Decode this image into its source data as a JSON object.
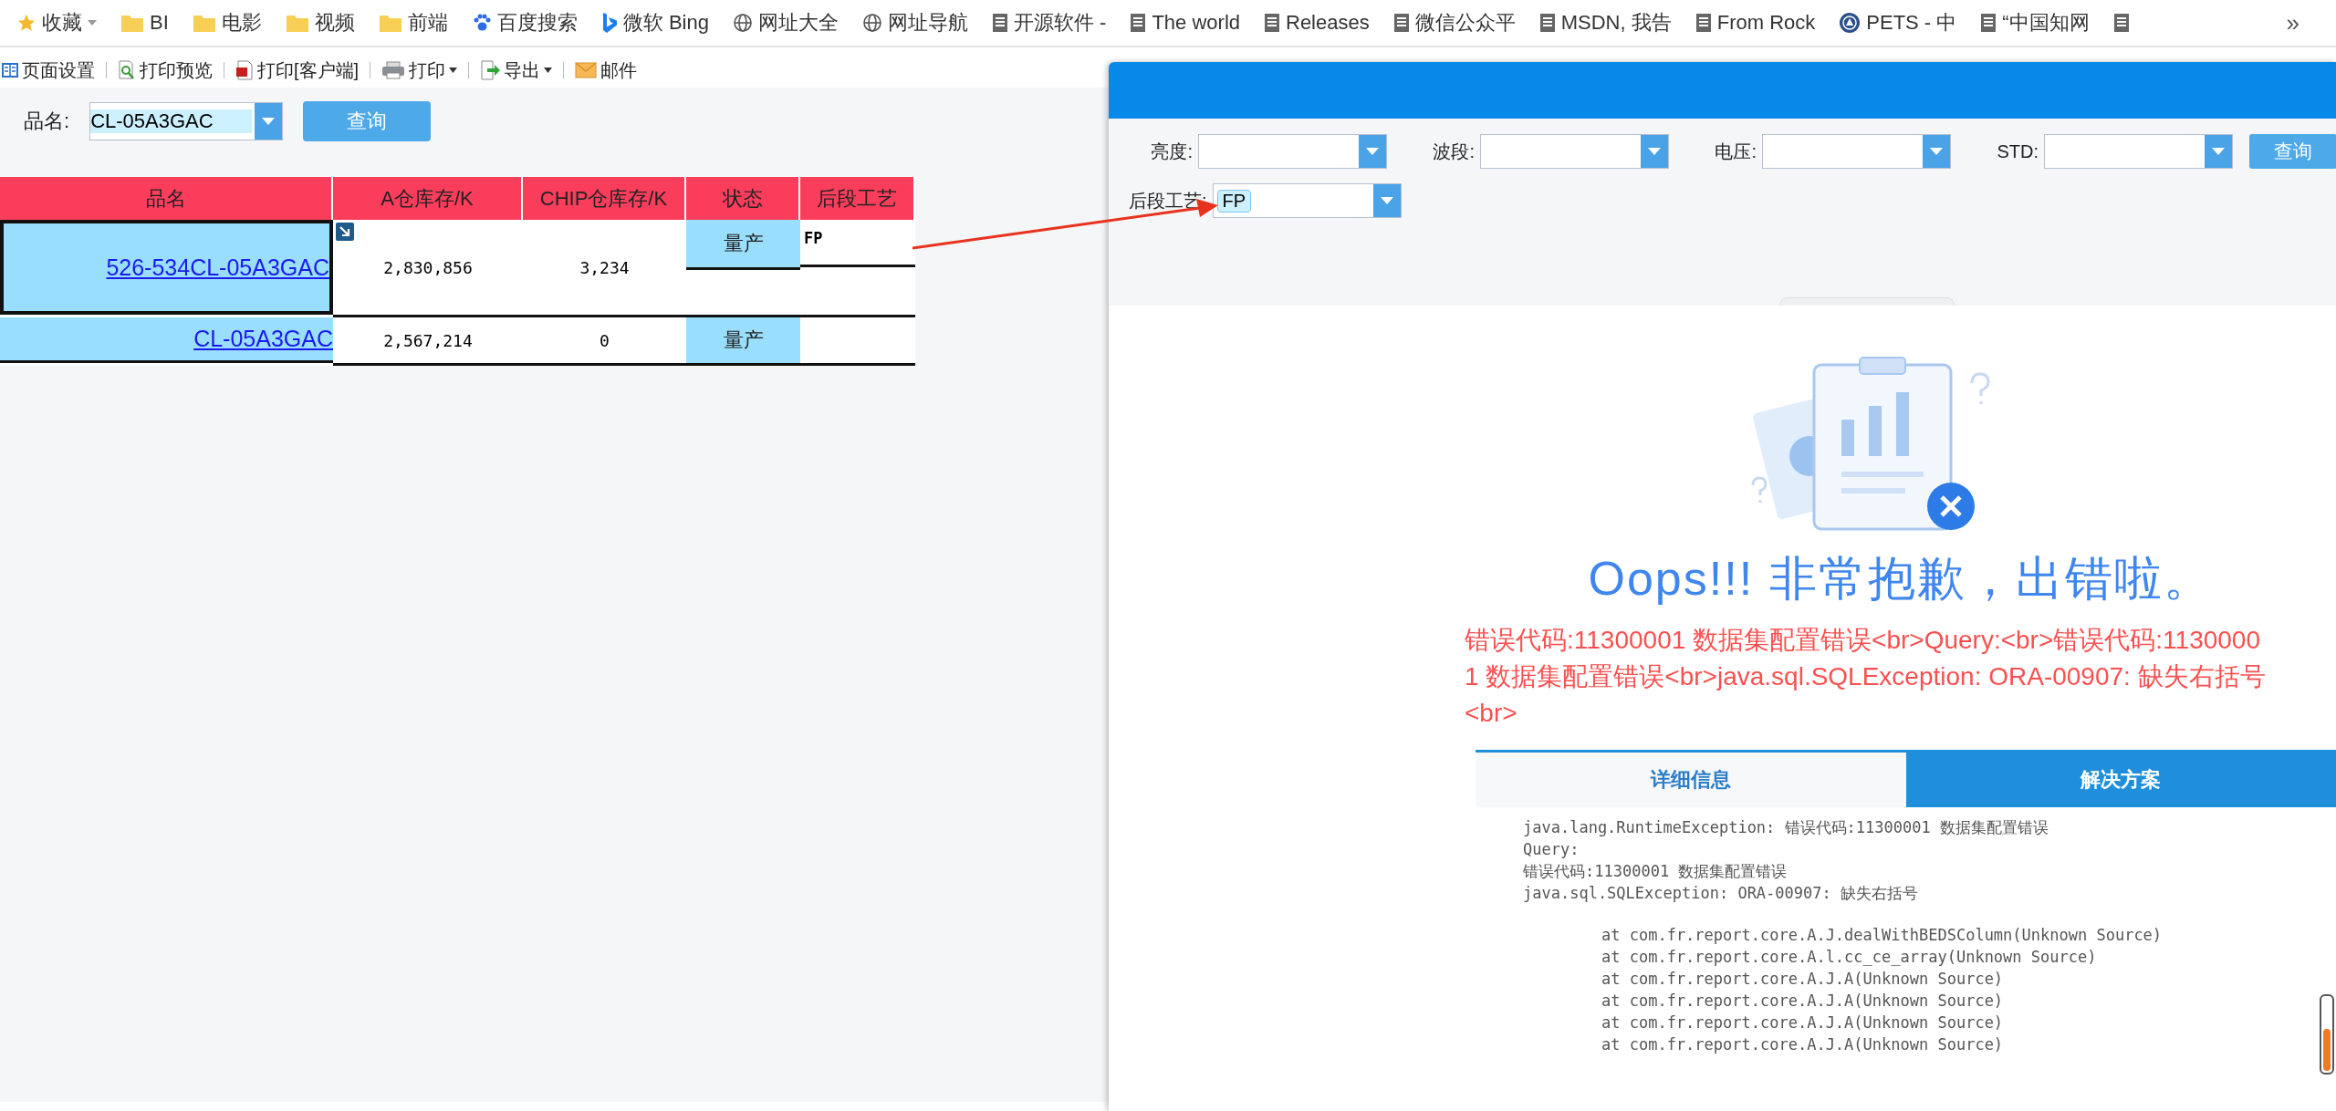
{
  "bookmarks": [
    {
      "kind": "star",
      "label": "收藏",
      "dropdown": true
    },
    {
      "kind": "folder",
      "label": "BI",
      "dropdown": false
    },
    {
      "kind": "folder",
      "label": "电影",
      "dropdown": false
    },
    {
      "kind": "folder",
      "label": "视频",
      "dropdown": false
    },
    {
      "kind": "folder",
      "label": "前端",
      "dropdown": false
    },
    {
      "kind": "paw",
      "label": "百度搜索",
      "dropdown": false
    },
    {
      "kind": "bing",
      "label": "微软 Bing",
      "dropdown": false
    },
    {
      "kind": "globe",
      "label": "网址大全",
      "dropdown": false
    },
    {
      "kind": "globe",
      "label": "网址导航",
      "dropdown": false
    },
    {
      "kind": "page",
      "label": "开源软件 -",
      "dropdown": false
    },
    {
      "kind": "page",
      "label": "The world",
      "dropdown": false
    },
    {
      "kind": "page",
      "label": "Releases",
      "dropdown": false
    },
    {
      "kind": "page",
      "label": "微信公众平",
      "dropdown": false
    },
    {
      "kind": "page",
      "label": "MSDN, 我告",
      "dropdown": false
    },
    {
      "kind": "page",
      "label": "From Rock",
      "dropdown": false
    },
    {
      "kind": "seal",
      "label": "PETS - 中",
      "dropdown": false
    },
    {
      "kind": "page",
      "label": "“中国知网",
      "dropdown": false
    },
    {
      "kind": "page",
      "dropdown": false
    }
  ],
  "bookmarks_overflow": "»",
  "toolbar": [
    {
      "kind": "layout",
      "label": "页面设置",
      "dropdown": false
    },
    {
      "kind": "preview",
      "label": "打印预览",
      "dropdown": false
    },
    {
      "kind": "pdf",
      "label": "打印[客户端]",
      "dropdown": false
    },
    {
      "kind": "printer",
      "label": "打印",
      "dropdown": true
    },
    {
      "kind": "export",
      "label": "导出",
      "dropdown": true
    },
    {
      "kind": "mail",
      "label": "邮件",
      "dropdown": false
    }
  ],
  "report": {
    "filter": {
      "label": "品名:",
      "value": "CL-05A3GAC",
      "button": "查询"
    },
    "table": {
      "columns": [
        "品名",
        "A仓库存/K",
        "CHIP仓库存/K",
        "状态",
        "后段工艺"
      ],
      "rows": [
        {
          "name": "526-534CL-05A3GAC",
          "a_stock": "2,830,856",
          "chip_stock": "3,234",
          "status": "量产",
          "process": "FP",
          "selected": true
        },
        {
          "name": "CL-05A3GAC",
          "a_stock": "2,567,214",
          "chip_stock": "0",
          "status": "量产",
          "selected": false
        }
      ]
    }
  },
  "dialog": {
    "filters": [
      {
        "label": "亮度:"
      },
      {
        "label": "波段:"
      },
      {
        "label": "电压:"
      },
      {
        "label": "STD:"
      },
      {
        "label": "后段工艺:",
        "value": "FP"
      }
    ],
    "query_button": "查询",
    "error": {
      "title": "Oops!!! 非常抱歉，出错啦。",
      "message": "错误代码:11300001 数据集配置错误<br>Query:<br>错误代码:11300001 数据集配置错误<br>java.sql.SQLException: ORA-00907: 缺失右括号<br>",
      "tabs": [
        {
          "label": "详细信息",
          "selected": true
        },
        {
          "label": "解决方案",
          "selected": false
        }
      ],
      "trace": [
        {
          "kind": "head",
          "text": "java.lang.RuntimeException: 错误代码:11300001 数据集配置错误"
        },
        {
          "kind": "head",
          "text": "Query:"
        },
        {
          "kind": "head",
          "text": "错误代码:11300001 数据集配置错误"
        },
        {
          "kind": "head",
          "text": "java.sql.SQLException: ORA-00907: 缺失右括号"
        },
        {
          "kind": "frame",
          "text": "at com.fr.report.core.A.J.dealWithBEDSColumn(Unknown Source)"
        },
        {
          "kind": "frame",
          "text": "at com.fr.report.core.A.l.cc_ce_array(Unknown Source)"
        },
        {
          "kind": "frame",
          "text": "at com.fr.report.core.A.J.A(Unknown Source)"
        },
        {
          "kind": "frame",
          "text": "at com.fr.report.core.A.J.A(Unknown Source)"
        },
        {
          "kind": "frame",
          "text": "at com.fr.report.core.A.J.A(Unknown Source)"
        },
        {
          "kind": "frame",
          "text": "at com.fr.report.core.A.J.A(Unknown Source)"
        }
      ]
    }
  }
}
